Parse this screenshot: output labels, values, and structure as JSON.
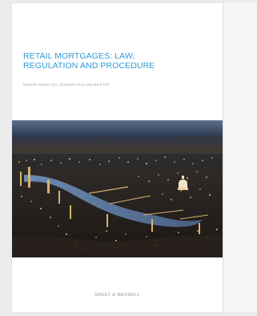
{
  "cover": {
    "title": "RETAIL MORTGAGES: LAW,\nREGULATION AND PROCEDURE",
    "authors": "Malcolm Waters QC, Elizabeth Grey and Mark Fell",
    "publisher": "SWEET & MAXWELL",
    "image_description": "night-city-river-aerial-photo"
  },
  "colors": {
    "title": "#2f9bd6",
    "background": "#ececec",
    "cover": "#ffffff",
    "sidebar": "#f6f6f6"
  }
}
